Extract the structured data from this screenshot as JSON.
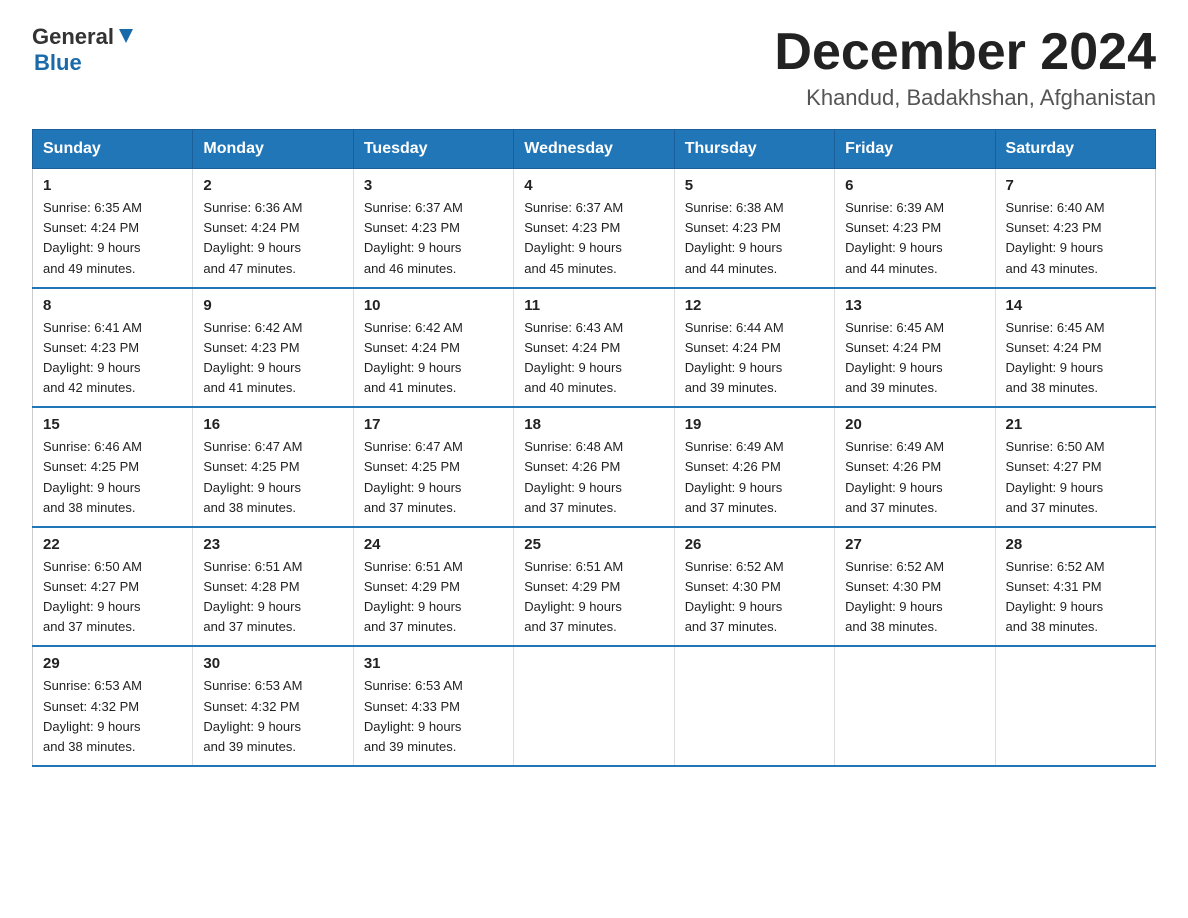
{
  "header": {
    "logo_general": "General",
    "logo_blue": "Blue",
    "title": "December 2024",
    "subtitle": "Khandud, Badakhshan, Afghanistan"
  },
  "days_of_week": [
    "Sunday",
    "Monday",
    "Tuesday",
    "Wednesday",
    "Thursday",
    "Friday",
    "Saturday"
  ],
  "weeks": [
    [
      {
        "day": "1",
        "sunrise": "6:35 AM",
        "sunset": "4:24 PM",
        "daylight": "9 hours and 49 minutes."
      },
      {
        "day": "2",
        "sunrise": "6:36 AM",
        "sunset": "4:24 PM",
        "daylight": "9 hours and 47 minutes."
      },
      {
        "day": "3",
        "sunrise": "6:37 AM",
        "sunset": "4:23 PM",
        "daylight": "9 hours and 46 minutes."
      },
      {
        "day": "4",
        "sunrise": "6:37 AM",
        "sunset": "4:23 PM",
        "daylight": "9 hours and 45 minutes."
      },
      {
        "day": "5",
        "sunrise": "6:38 AM",
        "sunset": "4:23 PM",
        "daylight": "9 hours and 44 minutes."
      },
      {
        "day": "6",
        "sunrise": "6:39 AM",
        "sunset": "4:23 PM",
        "daylight": "9 hours and 44 minutes."
      },
      {
        "day": "7",
        "sunrise": "6:40 AM",
        "sunset": "4:23 PM",
        "daylight": "9 hours and 43 minutes."
      }
    ],
    [
      {
        "day": "8",
        "sunrise": "6:41 AM",
        "sunset": "4:23 PM",
        "daylight": "9 hours and 42 minutes."
      },
      {
        "day": "9",
        "sunrise": "6:42 AM",
        "sunset": "4:23 PM",
        "daylight": "9 hours and 41 minutes."
      },
      {
        "day": "10",
        "sunrise": "6:42 AM",
        "sunset": "4:24 PM",
        "daylight": "9 hours and 41 minutes."
      },
      {
        "day": "11",
        "sunrise": "6:43 AM",
        "sunset": "4:24 PM",
        "daylight": "9 hours and 40 minutes."
      },
      {
        "day": "12",
        "sunrise": "6:44 AM",
        "sunset": "4:24 PM",
        "daylight": "9 hours and 39 minutes."
      },
      {
        "day": "13",
        "sunrise": "6:45 AM",
        "sunset": "4:24 PM",
        "daylight": "9 hours and 39 minutes."
      },
      {
        "day": "14",
        "sunrise": "6:45 AM",
        "sunset": "4:24 PM",
        "daylight": "9 hours and 38 minutes."
      }
    ],
    [
      {
        "day": "15",
        "sunrise": "6:46 AM",
        "sunset": "4:25 PM",
        "daylight": "9 hours and 38 minutes."
      },
      {
        "day": "16",
        "sunrise": "6:47 AM",
        "sunset": "4:25 PM",
        "daylight": "9 hours and 38 minutes."
      },
      {
        "day": "17",
        "sunrise": "6:47 AM",
        "sunset": "4:25 PM",
        "daylight": "9 hours and 37 minutes."
      },
      {
        "day": "18",
        "sunrise": "6:48 AM",
        "sunset": "4:26 PM",
        "daylight": "9 hours and 37 minutes."
      },
      {
        "day": "19",
        "sunrise": "6:49 AM",
        "sunset": "4:26 PM",
        "daylight": "9 hours and 37 minutes."
      },
      {
        "day": "20",
        "sunrise": "6:49 AM",
        "sunset": "4:26 PM",
        "daylight": "9 hours and 37 minutes."
      },
      {
        "day": "21",
        "sunrise": "6:50 AM",
        "sunset": "4:27 PM",
        "daylight": "9 hours and 37 minutes."
      }
    ],
    [
      {
        "day": "22",
        "sunrise": "6:50 AM",
        "sunset": "4:27 PM",
        "daylight": "9 hours and 37 minutes."
      },
      {
        "day": "23",
        "sunrise": "6:51 AM",
        "sunset": "4:28 PM",
        "daylight": "9 hours and 37 minutes."
      },
      {
        "day": "24",
        "sunrise": "6:51 AM",
        "sunset": "4:29 PM",
        "daylight": "9 hours and 37 minutes."
      },
      {
        "day": "25",
        "sunrise": "6:51 AM",
        "sunset": "4:29 PM",
        "daylight": "9 hours and 37 minutes."
      },
      {
        "day": "26",
        "sunrise": "6:52 AM",
        "sunset": "4:30 PM",
        "daylight": "9 hours and 37 minutes."
      },
      {
        "day": "27",
        "sunrise": "6:52 AM",
        "sunset": "4:30 PM",
        "daylight": "9 hours and 38 minutes."
      },
      {
        "day": "28",
        "sunrise": "6:52 AM",
        "sunset": "4:31 PM",
        "daylight": "9 hours and 38 minutes."
      }
    ],
    [
      {
        "day": "29",
        "sunrise": "6:53 AM",
        "sunset": "4:32 PM",
        "daylight": "9 hours and 38 minutes."
      },
      {
        "day": "30",
        "sunrise": "6:53 AM",
        "sunset": "4:32 PM",
        "daylight": "9 hours and 39 minutes."
      },
      {
        "day": "31",
        "sunrise": "6:53 AM",
        "sunset": "4:33 PM",
        "daylight": "9 hours and 39 minutes."
      },
      null,
      null,
      null,
      null
    ]
  ],
  "labels": {
    "sunrise": "Sunrise:",
    "sunset": "Sunset:",
    "daylight": "Daylight:"
  }
}
